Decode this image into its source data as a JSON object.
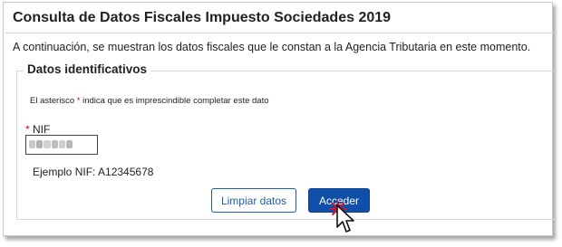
{
  "page": {
    "title": "Consulta de Datos Fiscales Impuesto Sociedades 2019",
    "intro": "A continuación, se muestran los datos fiscales que le constan a la Agencia Tributaria en este momento."
  },
  "form": {
    "legend": "Datos identificativos",
    "required_note_before": "El asterisco",
    "required_mark": "*",
    "required_note_after": "indica que es imprescindible completar este dato",
    "nif_required_mark": "*",
    "nif_label": "NIF",
    "nif_value": "",
    "example": "Ejemplo NIF: A12345678"
  },
  "buttons": {
    "clear_label": "Limpiar datos",
    "access_label": "Acceder"
  },
  "icons": {
    "cursor": "mouse-pointer-icon",
    "click": "click-burst-icon"
  },
  "colors": {
    "primary": "#0f4fa8",
    "required": "#d0102a",
    "text": "#222222"
  }
}
